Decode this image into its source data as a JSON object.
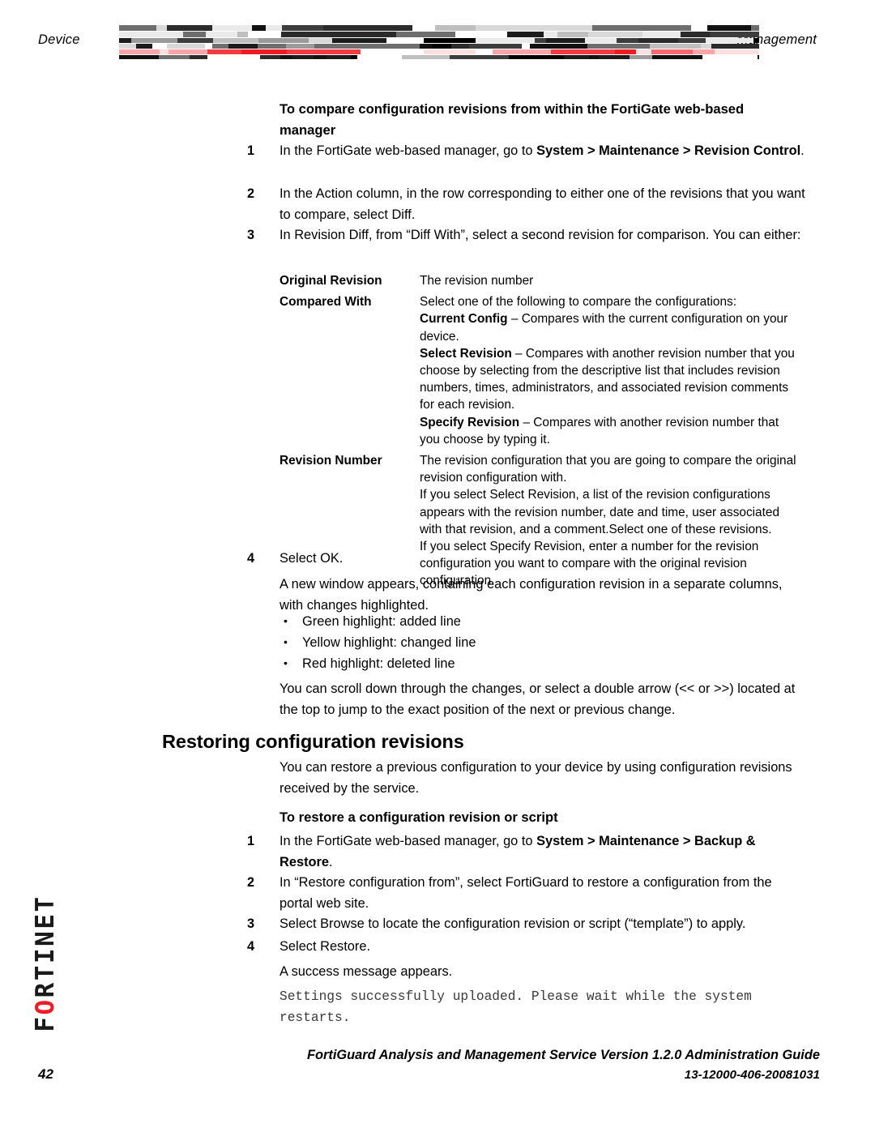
{
  "header": {
    "left_label": "Device",
    "right_label": "Management",
    "decoration": "fortinet-barcode-rule"
  },
  "brand": {
    "name_before_o": "F",
    "name_o": "O",
    "name_after_o": "RTINET",
    "accent_color": "#ee1c25"
  },
  "body": {
    "procedure_1_title": "To compare configuration revisions from within the FortiGate web-based manager",
    "steps_1": [
      {
        "num": "1",
        "parts": [
          {
            "text": "In the FortiGate web-based manager, go to ",
            "bold": false
          },
          {
            "text": "System > Maintenance > Revision Control",
            "bold": true
          },
          {
            "text": ".",
            "bold": false
          }
        ]
      },
      {
        "num": "2",
        "parts": [
          {
            "text": "In the Action column, in the row corresponding to either one of the revisions that you want to compare, select Diff.",
            "bold": false
          }
        ]
      },
      {
        "num": "3",
        "parts": [
          {
            "text": "In Revision Diff, from “Diff With”, select a second revision for comparison. You can either:",
            "bold": false
          }
        ]
      }
    ],
    "definition_table": [
      {
        "term": "Original Revision",
        "paragraphs": [
          [
            {
              "text": "The revision number",
              "bold": false
            }
          ]
        ]
      },
      {
        "term": "Compared With",
        "paragraphs": [
          [
            {
              "text": "Select one of the following to compare the configurations:",
              "bold": false
            }
          ],
          [
            {
              "text": "Current Config",
              "bold": true
            },
            {
              "text": " – Compares with the current configuration on your device.",
              "bold": false
            }
          ],
          [
            {
              "text": "Select Revision",
              "bold": true
            },
            {
              "text": " – Compares with another revision number that you choose by selecting from the descriptive list that includes revision numbers, times, administrators, and associated revision comments for each revision.",
              "bold": false
            }
          ],
          [
            {
              "text": "Specify Revision",
              "bold": true
            },
            {
              "text": " – Compares with another revision number that you choose by typing it.",
              "bold": false
            }
          ]
        ]
      },
      {
        "term": "Revision Number",
        "paragraphs": [
          [
            {
              "text": "The revision configuration that you are going to compare the original revision configuration with.",
              "bold": false
            }
          ],
          [
            {
              "text": "If you select Select Revision, a list of the revision configurations appears with the revision number, date and time, user associated with that revision, and a comment.Select one of these revisions.",
              "bold": false
            }
          ],
          [
            {
              "text": "If you select Specify Revision, enter a number for the revision configuration you want to compare with the original revision configuration.",
              "bold": false
            }
          ]
        ]
      }
    ],
    "step_4_num": "4",
    "step_4_text": "Select OK.",
    "after_step_4": "A new window appears, containing each configuration revision in a separate columns, with changes highlighted.",
    "highlight_bullets": [
      "Green highlight: added line",
      "Yellow highlight: changed line",
      "Red highlight: deleted line"
    ],
    "scroll_note": "You can scroll down through the changes, or select a double arrow (<< or >>) located at the top to jump to the exact position of the next or previous change.",
    "section_heading": "Restoring configuration revisions",
    "section_intro": "You can restore a previous configuration to your device by using configuration revisions received by the service.",
    "procedure_2_title": "To restore a configuration revision or script",
    "steps_2": [
      {
        "num": "1",
        "parts": [
          {
            "text": "In the FortiGate web-based manager, go to ",
            "bold": false
          },
          {
            "text": "System > Maintenance > Backup & Restore",
            "bold": true
          },
          {
            "text": ".",
            "bold": false
          }
        ]
      },
      {
        "num": "2",
        "parts": [
          {
            "text": "In “Restore configuration from”, select FortiGuard to restore a configuration from the portal web site.",
            "bold": false
          }
        ]
      },
      {
        "num": "3",
        "parts": [
          {
            "text": "Select Browse to locate the configuration revision or script (“template”) to apply.",
            "bold": false
          }
        ]
      },
      {
        "num": "4",
        "parts": [
          {
            "text": "Select Restore.",
            "bold": false
          }
        ]
      }
    ],
    "success_note": "A success message appears.",
    "cli_output": "Settings successfully uploaded. Please wait while the system restarts."
  },
  "footer": {
    "guide_title": "FortiGuard Analysis and Management Service Version 1.2.0 Administration Guide",
    "doc_code": "13-12000-406-20081031",
    "page_number": "42"
  }
}
